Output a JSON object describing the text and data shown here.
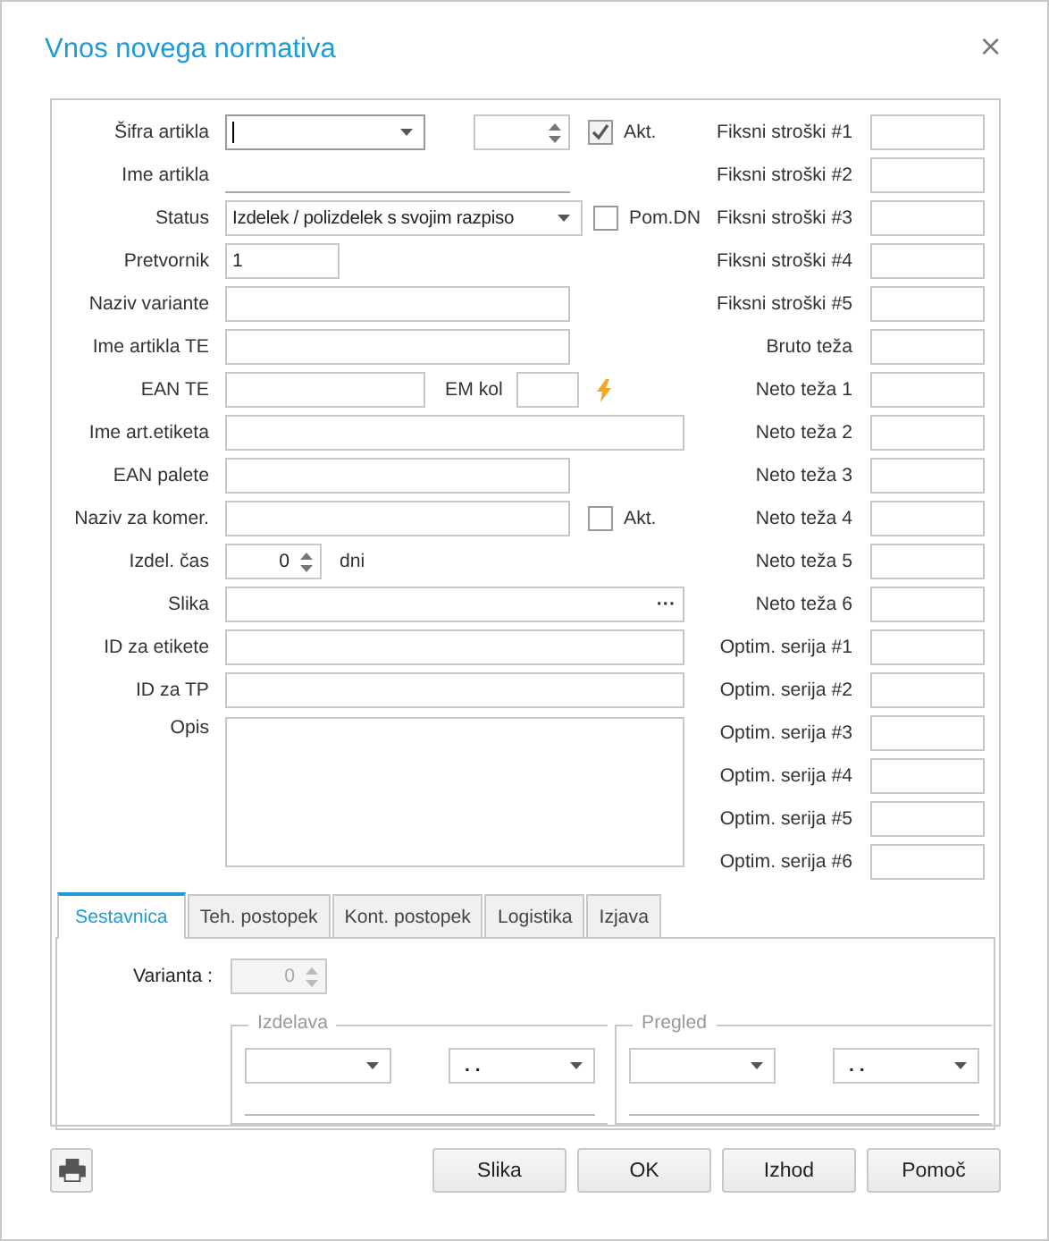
{
  "window": {
    "title": "Vnos novega normativa",
    "close_glyph": "×"
  },
  "sifra_artikla": {
    "label": "Šifra artikla"
  },
  "akt_1": {
    "label": "Akt.",
    "checked": true
  },
  "ime_artikla": {
    "label": "Ime artikla"
  },
  "status": {
    "label": "Status",
    "value": "Izdelek / polizdelek s svojim razpiso"
  },
  "pom_dn": {
    "label": "Pom.DN",
    "checked": false
  },
  "pretvornik": {
    "label": "Pretvornik",
    "value": "1"
  },
  "naziv_variante": {
    "label": "Naziv variante"
  },
  "ime_artikla_te": {
    "label": "Ime artikla TE"
  },
  "ean_te": {
    "label": "EAN TE"
  },
  "em_kol": {
    "label": "EM kol"
  },
  "ime_art_etiketa": {
    "label": "Ime art.etiketa"
  },
  "ean_palete": {
    "label": "EAN palete"
  },
  "naziv_za_komer": {
    "label": "Naziv za komer."
  },
  "akt_2": {
    "label": "Akt.",
    "checked": false
  },
  "izdel_cas": {
    "label": "Izdel. čas",
    "value": "0",
    "unit": "dni"
  },
  "slika": {
    "label": "Slika",
    "browse_glyph": "···"
  },
  "id_za_etikete": {
    "label": "ID za etikete"
  },
  "id_za_tp": {
    "label": "ID za TP"
  },
  "opis": {
    "label": "Opis"
  },
  "right_fields": [
    {
      "label": "Fiksni stroški #1"
    },
    {
      "label": "Fiksni stroški #2"
    },
    {
      "label": "Fiksni stroški #3"
    },
    {
      "label": "Fiksni stroški #4"
    },
    {
      "label": "Fiksni stroški #5"
    },
    {
      "label": "Bruto teža"
    },
    {
      "label": "Neto teža 1"
    },
    {
      "label": "Neto teža 2"
    },
    {
      "label": "Neto teža 3"
    },
    {
      "label": "Neto teža 4"
    },
    {
      "label": "Neto teža 5"
    },
    {
      "label": "Neto teža 6"
    },
    {
      "label": "Optim. serija #1"
    },
    {
      "label": "Optim. serija #2"
    },
    {
      "label": "Optim. serija #3"
    },
    {
      "label": "Optim. serija #4"
    },
    {
      "label": "Optim. serija #5"
    },
    {
      "label": "Optim. serija #6"
    }
  ],
  "tabs": [
    {
      "label": "Sestavnica",
      "selected": true
    },
    {
      "label": "Teh. postopek",
      "selected": false
    },
    {
      "label": "Kont. postopek",
      "selected": false
    },
    {
      "label": "Logistika",
      "selected": false
    },
    {
      "label": "Izjava",
      "selected": false
    }
  ],
  "varianta": {
    "label": "Varianta :",
    "value": "0",
    "disabled": true
  },
  "groups": [
    {
      "title": "Izdelava",
      "date_value": ".  ."
    },
    {
      "title": "Pregled",
      "date_value": ".  ."
    }
  ],
  "buttons": [
    {
      "label": "Slika"
    },
    {
      "label": "OK"
    },
    {
      "label": "Izhod"
    },
    {
      "label": "Pomoč"
    }
  ]
}
